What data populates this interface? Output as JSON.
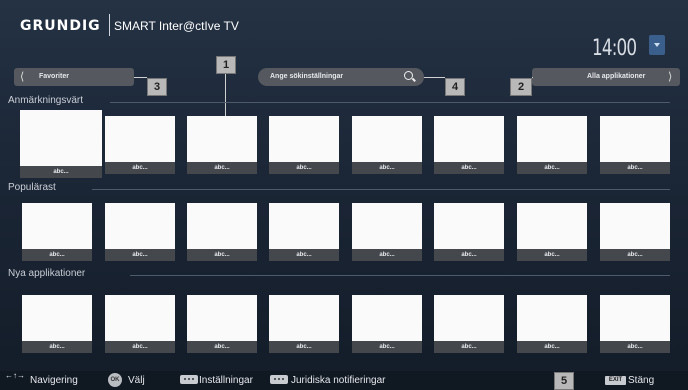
{
  "header": {
    "brand": "GRUNDIG",
    "title": "SMART Inter@ctIve TV",
    "clock": "14:00"
  },
  "toolbar": {
    "favorites_label": "Favoriter",
    "search_placeholder": "Ange sökinställningar",
    "all_apps_label": "Alla applikationer"
  },
  "callouts": [
    "1",
    "2",
    "3",
    "4",
    "5"
  ],
  "sections": [
    {
      "title": "Anmärkningsvärt",
      "tiles": [
        "abc...",
        "abc...",
        "abc...",
        "abc...",
        "abc...",
        "abc...",
        "abc...",
        "abc..."
      ]
    },
    {
      "title": "Populärast",
      "tiles": [
        "abc...",
        "abc...",
        "abc...",
        "abc...",
        "abc...",
        "abc...",
        "abc...",
        "abc..."
      ]
    },
    {
      "title": "Nya applikationer",
      "tiles": [
        "abc...",
        "abc...",
        "abc...",
        "abc...",
        "abc...",
        "abc...",
        "abc...",
        "abc..."
      ]
    }
  ],
  "bottom_bar": {
    "navigation": "Navigering",
    "ok_key": "OK",
    "select": "Välj",
    "settings": "Inställningar",
    "legal": "Juridiska notifieringar",
    "exit_key": "EXIT",
    "close": "Stäng"
  },
  "colors": {
    "background": "#1b2636",
    "tile": "#fafafa",
    "tile_caption": "#44484d",
    "pill": "#55595f",
    "callout": "#b8b8b8"
  }
}
